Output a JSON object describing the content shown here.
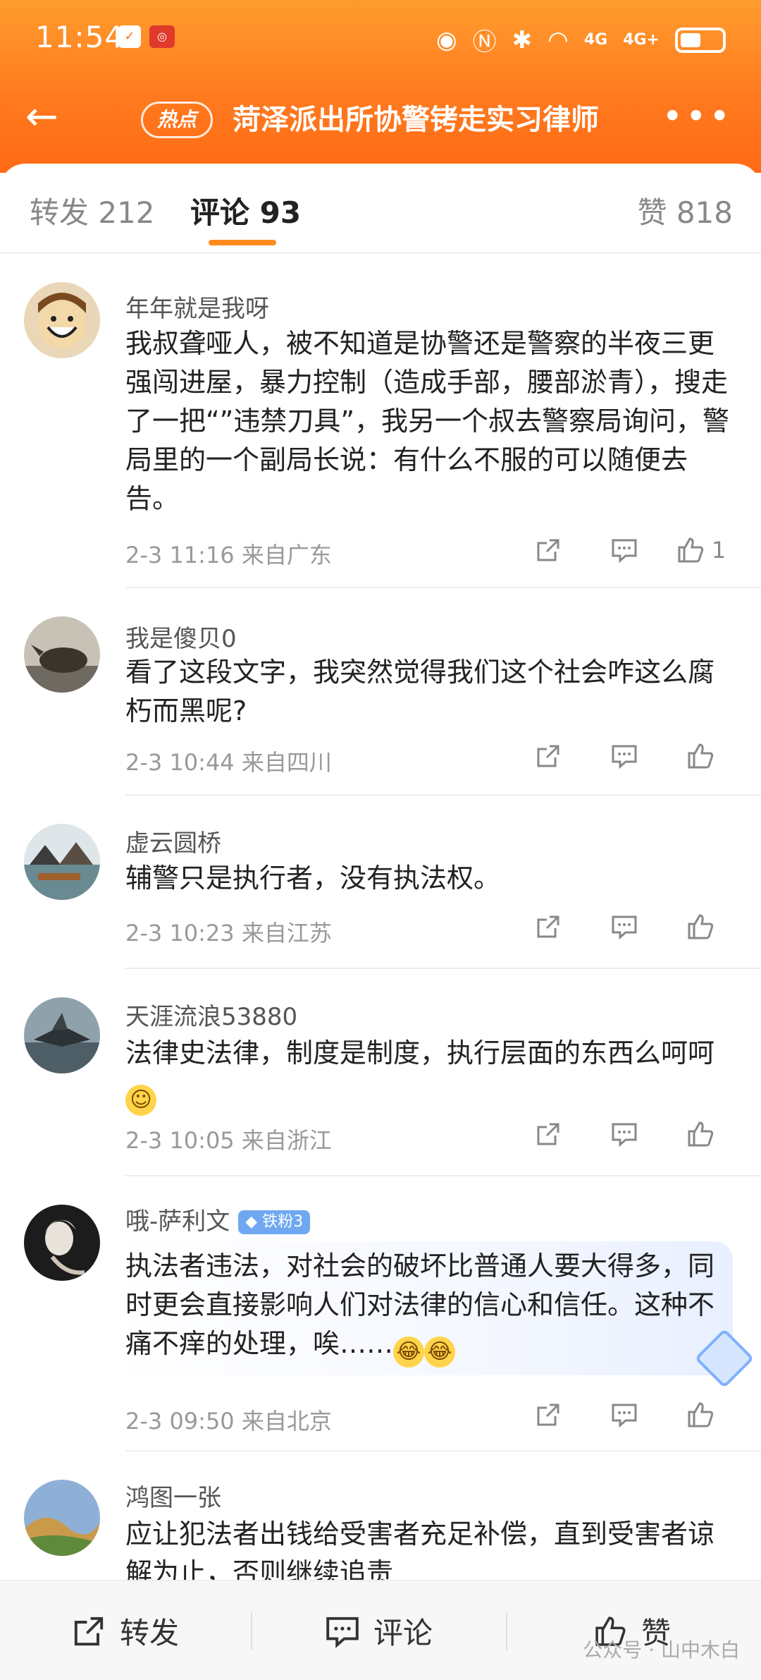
{
  "status_bar": {
    "time": "11:54",
    "net1": "4G",
    "net2": "4G+"
  },
  "nav": {
    "hot_tag": "热点",
    "title": "菏泽派出所协警铐走实习律师"
  },
  "tabs": {
    "repost": "转发 212",
    "comment": "评论 93",
    "like": "赞 818"
  },
  "comments": [
    {
      "user": "年年就是我呀",
      "text": "我叔聋哑人，被不知道是协警还是警察的半夜三更强闯进屋，暴力控制（造成手部，腰部淤青），搜走了一把“”违禁刀具”，我另一个叔去警察局询问，警局里的一个副局长说：有什么不服的可以随便去告。",
      "time": "2-3 11:16 来自广东",
      "likes": "1"
    },
    {
      "user": "我是傻贝0",
      "text": "看了这段文字，我突然觉得我们这个社会咋这么腐朽而黑呢?",
      "time": "2-3 10:44 来自四川",
      "likes": ""
    },
    {
      "user": "虚云圆桥",
      "text": "辅警只是执行者，没有执法权。",
      "time": "2-3 10:23 来自江苏",
      "likes": ""
    },
    {
      "user": "天涯流浪53880",
      "text": "法律史法律，制度是制度，执行层面的东西么呵呵",
      "time": "2-3 10:05 来自浙江",
      "likes": ""
    },
    {
      "user": "哦-萨利文",
      "badge": "铁粉3",
      "text": "执法者违法，对社会的破坏比普通人要大得多，同时更会直接影响人们对法律的信心和信任。这种不痛不痒的处理，唉……",
      "time": "2-3 09:50 来自北京",
      "likes": ""
    },
    {
      "user": "鸿图一张",
      "text": "应让犯法者出钱给受害者充足补偿，直到受害者谅解为止，否则继续追责",
      "time": "",
      "likes": ""
    }
  ],
  "bottom": {
    "repost": "转发",
    "comment": "评论",
    "like": "赞",
    "watermark": "公众号 · 山中木白"
  }
}
